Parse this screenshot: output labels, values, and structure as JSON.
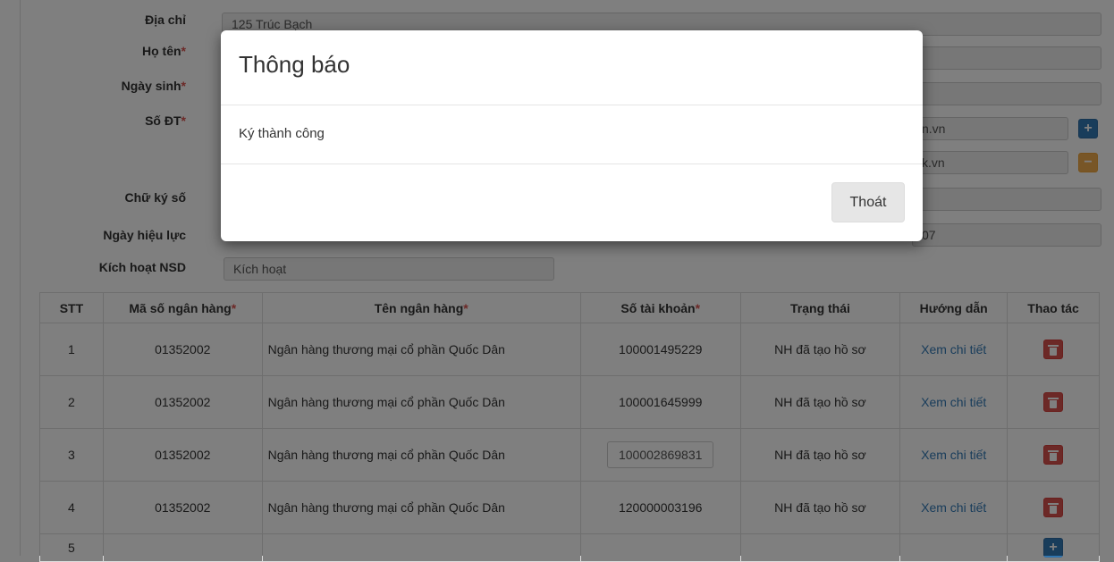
{
  "form": {
    "address_label": "Địa chỉ",
    "address_value": "125 Trúc Bạch",
    "fullname_label": "Họ tên",
    "birthdate_label": "Ngày sinh",
    "phone_label": "Số ĐT",
    "required_mark": "*",
    "email1_partial": "n.vn",
    "email2_partial": "k.vn",
    "signature_label": "Chữ ký số",
    "effective_date_label": "Ngày hiệu lực",
    "date_partial": "07",
    "activation_label": "Kích hoạt NSD",
    "activation_value": "Kích hoạt",
    "plus_icon": "+",
    "minus_icon": "−"
  },
  "table": {
    "headers": {
      "stt": "STT",
      "bank_code": "Mã số ngân hàng",
      "bank_name": "Tên ngân hàng",
      "account": "Số tài khoản",
      "status": "Trạng thái",
      "guide": "Hướng dẫn",
      "action": "Thao tác"
    },
    "rows": [
      {
        "stt": "1",
        "code": "01352002",
        "name": "Ngân hàng thương mại cổ phần Quốc Dân",
        "account": "100001495229",
        "status": "NH đã tạo hồ sơ",
        "guide": "Xem chi tiết"
      },
      {
        "stt": "2",
        "code": "01352002",
        "name": "Ngân hàng thương mại cổ phần Quốc Dân",
        "account": "100001645999",
        "status": "NH đã tạo hồ sơ",
        "guide": "Xem chi tiết"
      },
      {
        "stt": "3",
        "code": "01352002",
        "name": "Ngân hàng thương mại cổ phần Quốc Dân",
        "account": "100002869831",
        "status": "NH đã tạo hồ sơ",
        "guide": "Xem chi tiết"
      },
      {
        "stt": "4",
        "code": "01352002",
        "name": "Ngân hàng thương mại cổ phần Quốc Dân",
        "account": "120000003196",
        "status": "NH đã tạo hồ sơ",
        "guide": "Xem chi tiết"
      }
    ],
    "new_row_stt": "5",
    "add_icon": "+"
  },
  "modal": {
    "title": "Thông báo",
    "message": "Ký thành công",
    "close_button": "Thoát"
  }
}
